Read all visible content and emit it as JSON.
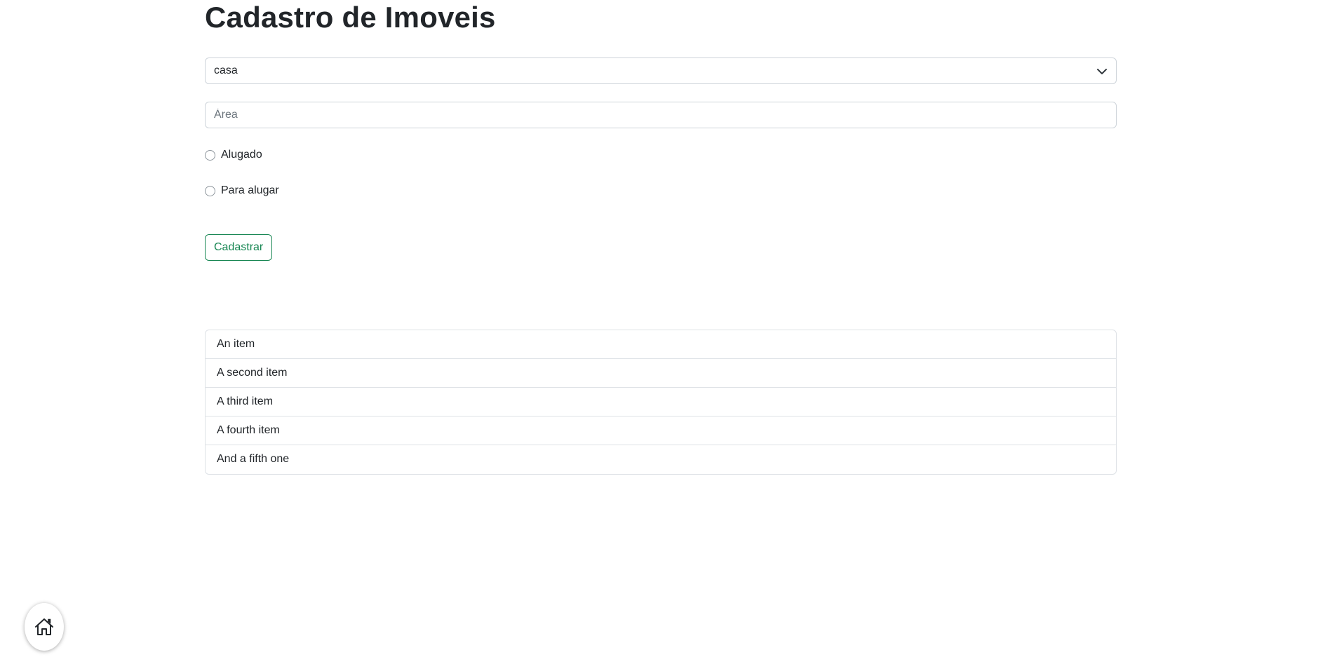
{
  "page": {
    "title": "Cadastro de Imoveis"
  },
  "form": {
    "type_select": {
      "selected": "casa",
      "icon": "chevron-down-icon"
    },
    "area_input": {
      "value": "",
      "placeholder": "Área"
    },
    "radios": [
      {
        "label": "Alugado",
        "checked": false
      },
      {
        "label": "Para alugar",
        "checked": false
      }
    ],
    "submit_label": "Cadastrar",
    "submit_color": "#198754"
  },
  "list": {
    "items": [
      "An item",
      "A second item",
      "A third item",
      "A fourth item",
      "And a fifth one"
    ]
  },
  "home_button": {
    "icon": "home-icon"
  }
}
